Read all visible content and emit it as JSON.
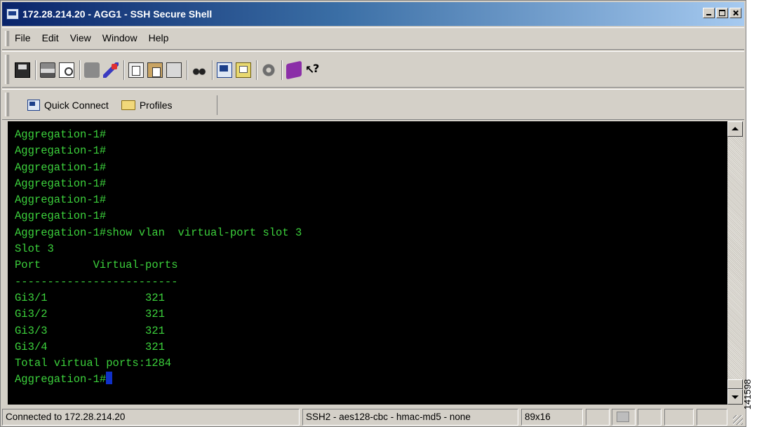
{
  "window": {
    "title": "172.28.214.20 - AGG1 - SSH Secure Shell",
    "controls": [
      "minimize",
      "maximize",
      "close"
    ]
  },
  "menu": {
    "items": [
      "File",
      "Edit",
      "View",
      "Window",
      "Help"
    ]
  },
  "toolbar": {
    "icons": [
      "save-icon",
      "print-icon",
      "print-preview-icon",
      "disabled-icon",
      "settings-wand-icon",
      "copy-icon",
      "paste-icon",
      "clipboard-icon",
      "find-icon",
      "new-terminal-icon",
      "new-file-transfer-icon",
      "settings-icon",
      "help-book-icon",
      "context-help-icon"
    ]
  },
  "connect_bar": {
    "quick_connect": "Quick Connect",
    "profiles": "Profiles"
  },
  "terminal": {
    "text_color": "#3cd13c",
    "background": "#000000",
    "lines": [
      "Aggregation-1#",
      "Aggregation-1#",
      "Aggregation-1#",
      "Aggregation-1#",
      "Aggregation-1#",
      "Aggregation-1#",
      "Aggregation-1#show vlan  virtual-port slot 3",
      "Slot 3",
      "Port        Virtual-ports",
      "-------------------------",
      "Gi3/1               321",
      "Gi3/2               321",
      "Gi3/3               321",
      "Gi3/4               321",
      "Total virtual ports:1284"
    ],
    "prompt": "Aggregation-1#"
  },
  "status": {
    "connection": "Connected to 172.28.214.20",
    "cipher": "SSH2 - aes128-cbc - hmac-md5 - none",
    "size": "89x16"
  },
  "side_id": "141598"
}
